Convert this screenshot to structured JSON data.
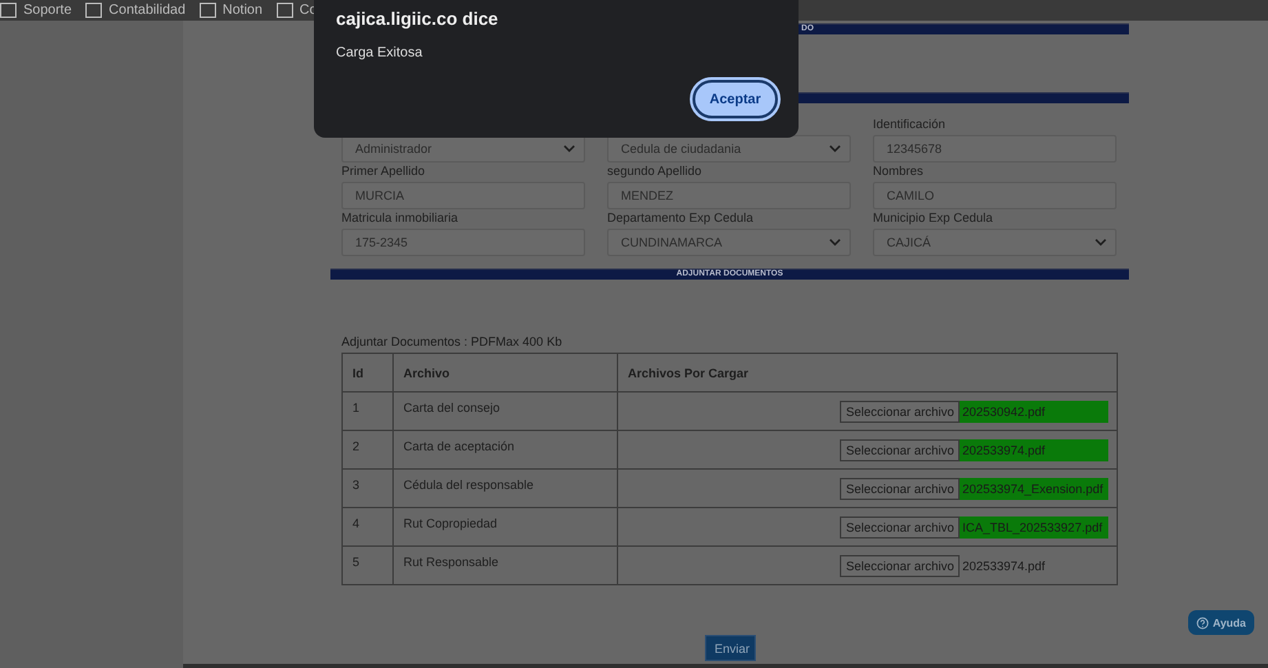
{
  "bookmarks": [
    "Soporte",
    "Contabilidad",
    "Notion",
    "Co"
  ],
  "dialog": {
    "title": "cajica.ligiic.co dice",
    "message": "Carga Exitosa",
    "button": "Aceptar"
  },
  "section_top": {
    "title": "DO"
  },
  "fields": [
    {
      "kind": "select",
      "value": "Administrador"
    },
    {
      "kind": "select",
      "value": "Cedula de ciudadania"
    },
    {
      "kind": "input",
      "label": "Identificación",
      "value": "12345678"
    },
    {
      "kind": "input",
      "label": "Primer Apellido",
      "value": "MURCIA"
    },
    {
      "kind": "input",
      "label": "segundo Apellido",
      "value": "MENDEZ"
    },
    {
      "kind": "input",
      "label": "Nombres",
      "value": "CAMILO"
    },
    {
      "kind": "input",
      "label": "Matricula inmobiliaria",
      "value": "175-2345"
    },
    {
      "kind": "select",
      "label": "Departamento Exp Cedula",
      "value": "CUNDINAMARCA"
    },
    {
      "kind": "select",
      "label": "Municipio Exp Cedula",
      "value": "CAJICÁ"
    }
  ],
  "section_docs": {
    "title": "ADJUNTAR DOCUMENTOS"
  },
  "caption": "Adjuntar Documentos : PDFMax 400 Kb",
  "table": {
    "columns": [
      "Id",
      "Archivo",
      "Archivos Por Cargar"
    ],
    "rows": [
      {
        "id": "1",
        "name": "Carta del consejo",
        "button": "Seleccionar archivo",
        "file": "202530942.pdf",
        "uploaded": true
      },
      {
        "id": "2",
        "name": "Carta de aceptación",
        "button": "Seleccionar archivo",
        "file": "202533974.pdf",
        "uploaded": true
      },
      {
        "id": "3",
        "name": "Cédula del responsable",
        "button": "Seleccionar archivo",
        "file": "202533974_Exension.pdf",
        "uploaded": true
      },
      {
        "id": "4",
        "name": "Rut Copropiedad",
        "button": "Seleccionar archivo",
        "file": "ICA_TBL_202533927.pdf",
        "uploaded": true
      },
      {
        "id": "5",
        "name": "Rut Responsable",
        "button": "Seleccionar archivo",
        "file": "202533974.pdf",
        "uploaded": false
      }
    ]
  },
  "submit": "Enviar",
  "help": "Ayuda"
}
